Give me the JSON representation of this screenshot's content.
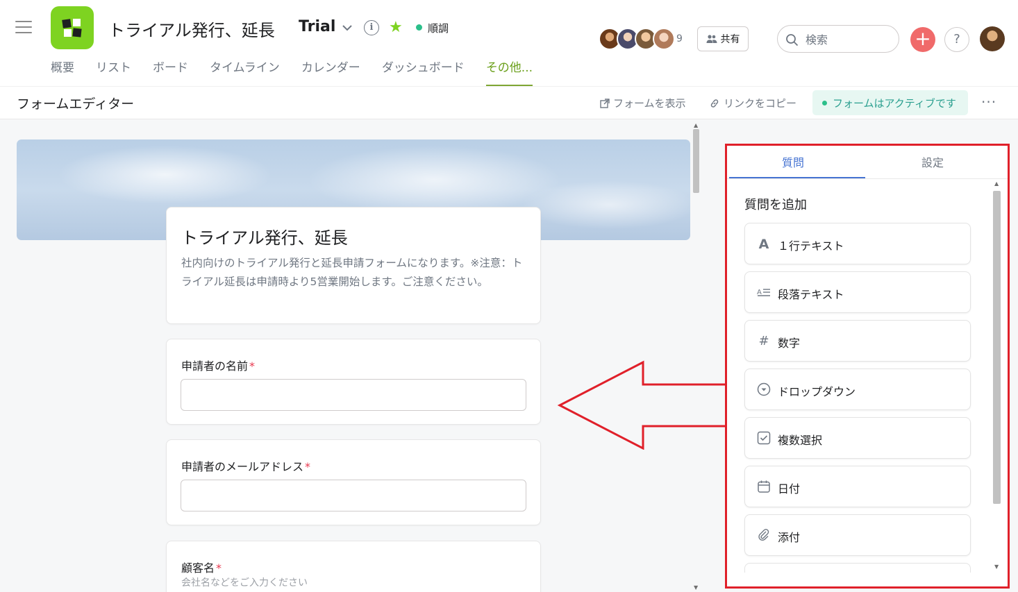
{
  "header": {
    "project_title": "トライアル発行、延長",
    "project_tag": "Trial",
    "status": "順調",
    "member_count": "9",
    "share_label": "共有",
    "search_placeholder": "検索",
    "add_symbol": "+",
    "help_symbol": "?"
  },
  "tabs": [
    {
      "label": "概要"
    },
    {
      "label": "リスト"
    },
    {
      "label": "ボード"
    },
    {
      "label": "タイムライン"
    },
    {
      "label": "カレンダー"
    },
    {
      "label": "ダッシュボード"
    },
    {
      "label": "その他..."
    }
  ],
  "subheader": {
    "title": "フォームエディター",
    "view_form": "フォームを表示",
    "copy_link": "リンクをコピー",
    "active_status": "フォームはアクティブです",
    "more": "···"
  },
  "form": {
    "title": "トライアル発行、延長",
    "description": "社内向けのトライアル発行と延長申請フォームになります。※注意：トライアル延長は申請時より5営業開始します。ご注意ください。",
    "questions": [
      {
        "label": "申請者の名前",
        "required_mark": "*"
      },
      {
        "label": "申請者のメールアドレス",
        "required_mark": "*"
      },
      {
        "label": "顧客名",
        "required_mark": "*",
        "hint": "会社名などをご入力ください"
      }
    ]
  },
  "panel": {
    "tab_questions": "質問",
    "tab_settings": "設定",
    "section_title": "質問を追加",
    "question_types": [
      {
        "label": "１行テキスト",
        "icon": "text-a-icon"
      },
      {
        "label": "段落テキスト",
        "icon": "paragraph-icon"
      },
      {
        "label": "数字",
        "icon": "hash-icon"
      },
      {
        "label": "ドロップダウン",
        "icon": "dropdown-icon"
      },
      {
        "label": "複数選択",
        "icon": "checkbox-icon"
      },
      {
        "label": "日付",
        "icon": "calendar-icon"
      },
      {
        "label": "添付",
        "icon": "paperclip-icon"
      }
    ]
  },
  "colors": {
    "accent_green": "#7ed321",
    "annotation_red": "#e0202a",
    "active_blue": "#4573d2"
  }
}
